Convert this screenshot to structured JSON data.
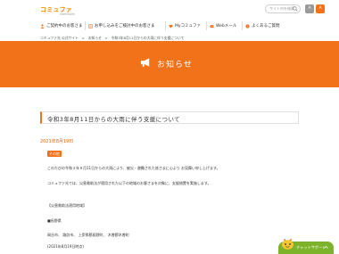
{
  "logo": {
    "main": "コミュファ",
    "sub": "commufa"
  },
  "search": {
    "placeholder": "サイト内を検索"
  },
  "a11y": {
    "small": "A",
    "large": "A"
  },
  "nav": {
    "items": [
      "ご契約中のお客さま",
      "お申し込みをご検討中のお客さま",
      "Myコミュファ",
      "Webメール",
      "よくあるご質問"
    ]
  },
  "breadcrumb": "コミュファ光 公式サイト　>　お知らせ　>　令和3年8月11日からの大雨に伴う支援について",
  "hero": {
    "title": "お知らせ"
  },
  "article": {
    "title": "令和3年8月11日からの大雨に伴う支援について",
    "date": "2021年8月19日",
    "tag": "その他",
    "paragraphs": [
      "このたびの令和３年８月11日からの大雨により、被災・避難された皆さまに心より お見舞い申し上げます。",
      "コミュファ光では、災害救助法が適用された以下の地域のお客さまを対象に、支援措置を実施します。",
      "【災害救助法適用地域】",
      "■長野県",
      "岡谷市、 諏訪市、 上伊那郡辰野町、 木曽郡木曽町",
      "(2021年8月19日時点)"
    ]
  },
  "chat": {
    "label": "チャットサポート"
  },
  "colors": {
    "accent": "#f27219",
    "chat": "#7cb32b"
  }
}
